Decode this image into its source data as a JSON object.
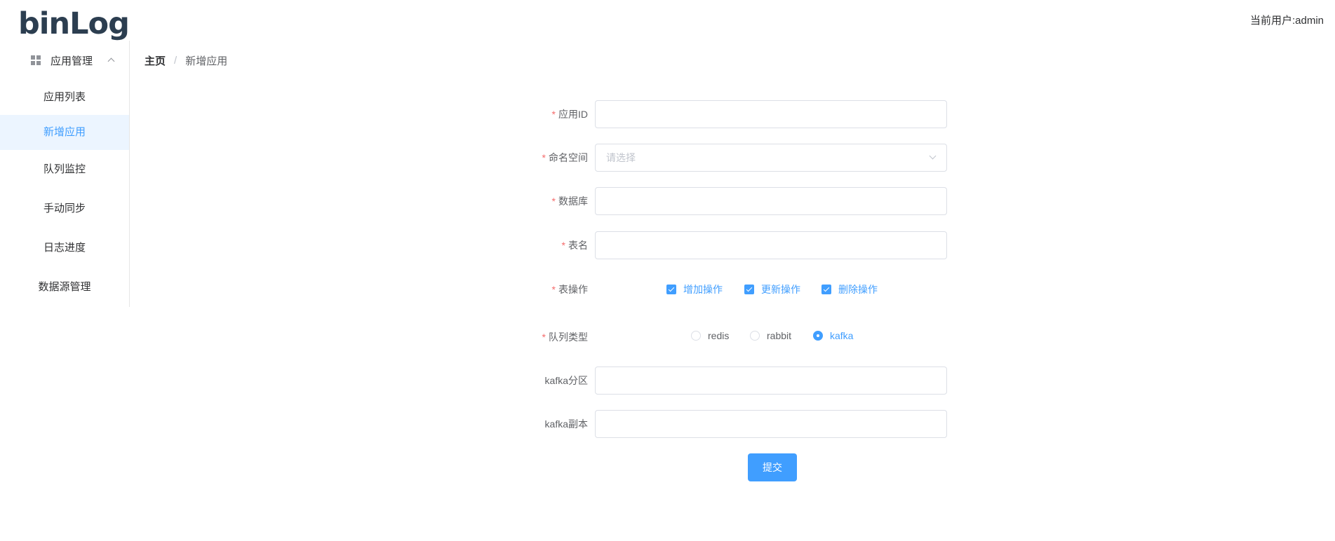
{
  "header": {
    "logo": "binLog",
    "current_user": "当前用户:admin"
  },
  "sidebar": {
    "group_label": "应用管理",
    "items": [
      {
        "label": "应用列表"
      },
      {
        "label": "新增应用",
        "active": true
      },
      {
        "label": "队列监控"
      },
      {
        "label": "手动同步"
      },
      {
        "label": "日志进度"
      },
      {
        "label": "数据源管理"
      }
    ]
  },
  "breadcrumb": {
    "home": "主页",
    "separator": "/",
    "current": "新增应用"
  },
  "form": {
    "app_id": {
      "label": "应用ID",
      "required_mark": "*",
      "value": ""
    },
    "namespace": {
      "label": "命名空间",
      "required_mark": "*",
      "placeholder": "请选择"
    },
    "database": {
      "label": "数据库",
      "required_mark": "*",
      "value": ""
    },
    "table_name": {
      "label": "表名",
      "required_mark": "*",
      "value": ""
    },
    "table_ops": {
      "label": "表操作",
      "required_mark": "*",
      "options": [
        {
          "label": "增加操作",
          "checked": true
        },
        {
          "label": "更新操作",
          "checked": true
        },
        {
          "label": "删除操作",
          "checked": true
        }
      ]
    },
    "queue_type": {
      "label": "队列类型",
      "required_mark": "*",
      "options": [
        {
          "label": "redis",
          "checked": false
        },
        {
          "label": "rabbit",
          "checked": false
        },
        {
          "label": "kafka",
          "checked": true
        }
      ]
    },
    "kafka_partition": {
      "label": "kafka分区",
      "value": ""
    },
    "kafka_replica": {
      "label": "kafka副本",
      "value": ""
    },
    "submit_label": "提交"
  },
  "colors": {
    "primary": "#409eff",
    "required": "#f56c6c",
    "active_bg": "#ecf5ff",
    "logo": "#2c3e50"
  }
}
